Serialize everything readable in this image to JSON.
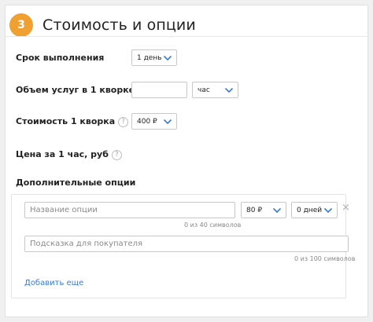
{
  "header": {
    "step_number": "3",
    "title": "Стоимость и опции",
    "step_color": "#f0a030"
  },
  "fields": {
    "deadline": {
      "label": "Срок выполнения",
      "value": "1 день"
    },
    "volume": {
      "label": "Объем услуг в 1 кворке",
      "help": "?",
      "input_value": "",
      "unit_value": "час"
    },
    "price": {
      "label": "Стоимость 1 кворка",
      "help": "?",
      "value": "400 ₽"
    },
    "hourly": {
      "label": "Цена за 1 час, руб",
      "help": "?"
    }
  },
  "extra_options": {
    "label": "Дополнительные опции",
    "name_placeholder": "Название опции",
    "name_value": "",
    "name_counter": "0 из 40 символов",
    "price_value": "80 ₽",
    "days_value": "0 дней",
    "remove_icon": "×",
    "hint_placeholder": "Подсказка для покупателя",
    "hint_value": "",
    "hint_counter": "0 из 100 символов",
    "add_more": "Добавить еще"
  },
  "colors": {
    "accent": "#f0a030",
    "link": "#3a7bd5",
    "chevron": "#3a7bd5"
  }
}
